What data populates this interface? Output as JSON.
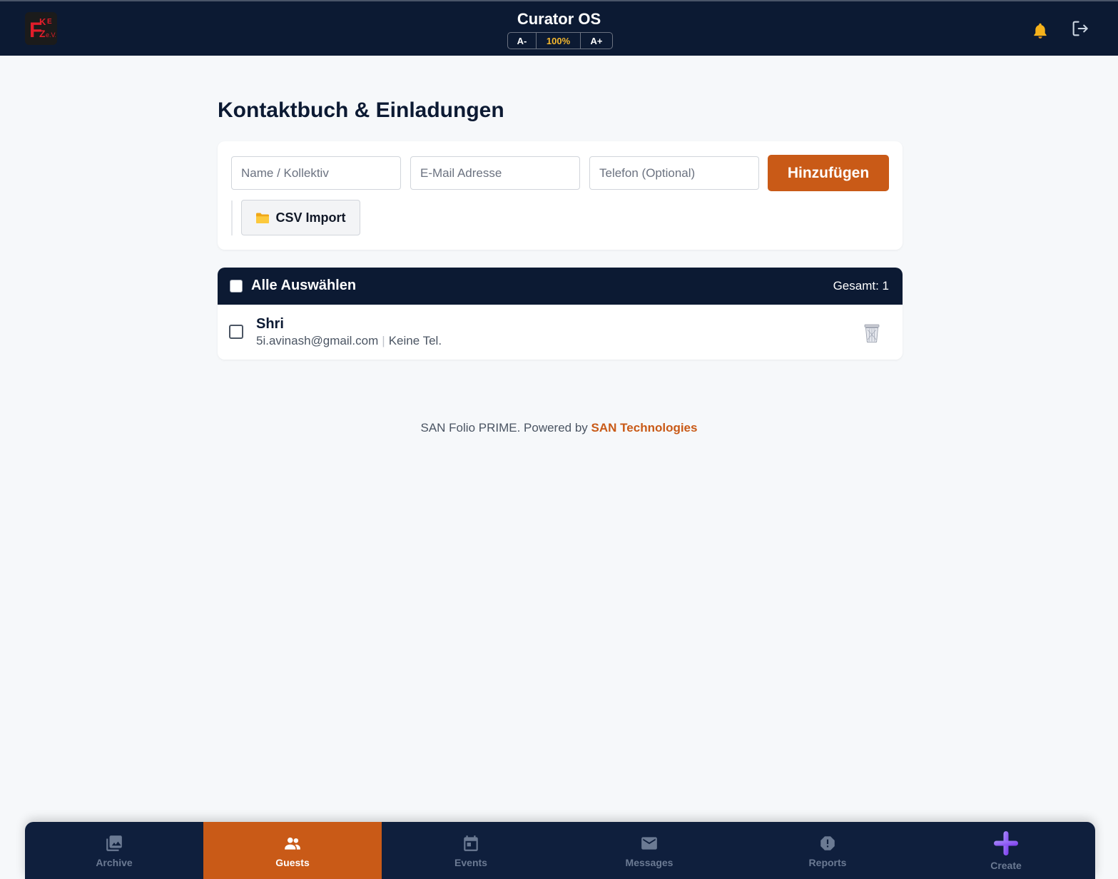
{
  "header": {
    "logo_text": "FKKE e.V.",
    "title": "Curator OS",
    "zoom": {
      "decrease": "A-",
      "value": "100%",
      "increase": "A+"
    }
  },
  "page": {
    "title": "Kontaktbuch & Einladungen"
  },
  "form": {
    "name_placeholder": "Name / Kollektiv",
    "email_placeholder": "E-Mail Adresse",
    "phone_placeholder": "Telefon (Optional)",
    "add_label": "Hinzufügen",
    "csv_label": "CSV Import"
  },
  "list": {
    "select_all_label": "Alle Auswählen",
    "total_label": "Gesamt: 1",
    "contacts": [
      {
        "name": "Shri",
        "email": "5i.avinash@gmail.com",
        "phone": "Keine Tel."
      }
    ]
  },
  "footer": {
    "text": "SAN Folio PRIME. Powered by",
    "brand": "SAN Technologies"
  },
  "nav": {
    "items": [
      {
        "label": "Archive",
        "icon": "archive-icon"
      },
      {
        "label": "Guests",
        "icon": "guests-icon",
        "active": true
      },
      {
        "label": "Events",
        "icon": "events-icon"
      },
      {
        "label": "Messages",
        "icon": "messages-icon"
      },
      {
        "label": "Reports",
        "icon": "reports-icon"
      },
      {
        "label": "Create",
        "icon": "create-icon"
      }
    ]
  },
  "colors": {
    "navy": "#0c1a33",
    "accent": "#c95a17",
    "zoom_value": "#f5b82e",
    "create_icon": "#8b5cf6"
  }
}
